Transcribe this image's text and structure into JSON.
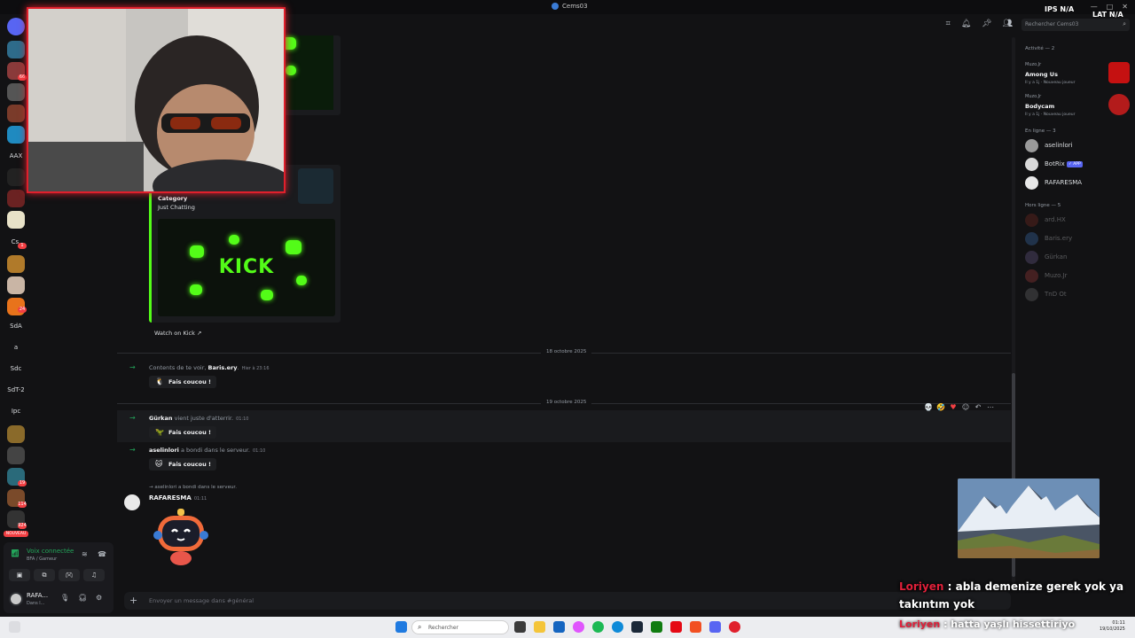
{
  "window": {
    "title": "Cems03"
  },
  "search": {
    "placeholder": "Rechercher Cems03"
  },
  "rail": {
    "labels": [
      "AAX",
      "Cs.",
      "SdA",
      "a",
      "Sdc",
      "SdT-2",
      "Ipc"
    ],
    "badges": [
      "66",
      "1",
      "24",
      "19",
      "114",
      "924"
    ],
    "new_label": "NOUVEAU"
  },
  "voice": {
    "status": "Voix connectée",
    "channel": "BFA / Gameur"
  },
  "user": {
    "name": "RAFA...",
    "status": "Dans l..."
  },
  "embed": {
    "category_label": "Category",
    "category_value": "Just Chatting",
    "kick_text": "KICK",
    "watch_label": "Watch on Kick"
  },
  "dates": {
    "first": "18 octobre 2025",
    "second": "19 octobre 2025"
  },
  "system_messages": [
    {
      "pre": "Contents de te voir, ",
      "name": "Baris.ery",
      "post": ".",
      "time": "Hier à 23:16",
      "button": "Fais coucou !",
      "emoji": "🐧"
    },
    {
      "pre": "",
      "name": "Gürkan",
      "post": " vient juste d'atterrir.",
      "time": "01:10",
      "button": "Fais coucou !",
      "emoji": "🦖"
    },
    {
      "pre": "",
      "name": "aselinlori",
      "post": " a bondi dans le serveur.",
      "time": "01:10",
      "button": "Fais coucou !",
      "emoji": "🐱"
    }
  ],
  "reply_message": {
    "reply_preview": "→ aselinlori a bondi dans le serveur.",
    "author": "RAFARESMA",
    "time": "01:11"
  },
  "composer": {
    "placeholder": "Envoyer un message dans #général"
  },
  "members": {
    "activity_header": "Activité — 2",
    "activities": [
      {
        "user": "Muzo.Jr",
        "game": "Among Us",
        "sub": "Il y a 1j · Nouveau joueur",
        "color": "#c51111"
      },
      {
        "user": "Muzo.Jr",
        "game": "Bodycam",
        "sub": "Il y a 1j · Nouveau joueur",
        "color": "#b31b1b"
      }
    ],
    "online_header": "En ligne — 3",
    "online": [
      {
        "name": "aselinlori",
        "color": "#9a9a9a"
      },
      {
        "name": "BotRix",
        "color": "#d9d9d9",
        "tag": "✓ APP"
      },
      {
        "name": "RAFARESMA",
        "color": "#e8e8e8"
      }
    ],
    "offline_header": "Hors ligne — 5",
    "offline": [
      {
        "name": "ard.HX",
        "color": "#7a2a20"
      },
      {
        "name": "Baris.ery",
        "color": "#3a6fb0"
      },
      {
        "name": "Gürkan",
        "color": "#6a5a8a"
      },
      {
        "name": "Muzo.Jr",
        "color": "#a33a3a"
      },
      {
        "name": "TnD Ot",
        "color": "#6d6d6d"
      }
    ]
  },
  "overlay": {
    "top_left_text": "IPS N/A",
    "top_right_text": "LAT N/A",
    "chat_line_nick": "Loriyen",
    "chat_line_text": " : abla demenize gerek yok ya takıntım yok",
    "ghost_nick": "Loriyen",
    "ghost_text": " : hatta yaşlı hissettiriyo"
  },
  "taskbar": {
    "search_placeholder": "Rechercher",
    "time": "01:11",
    "date": "19/10/2025"
  },
  "colors": {
    "kick_green": "#53fc18",
    "accent_red": "#e0202c",
    "online_green": "#23a55a"
  }
}
